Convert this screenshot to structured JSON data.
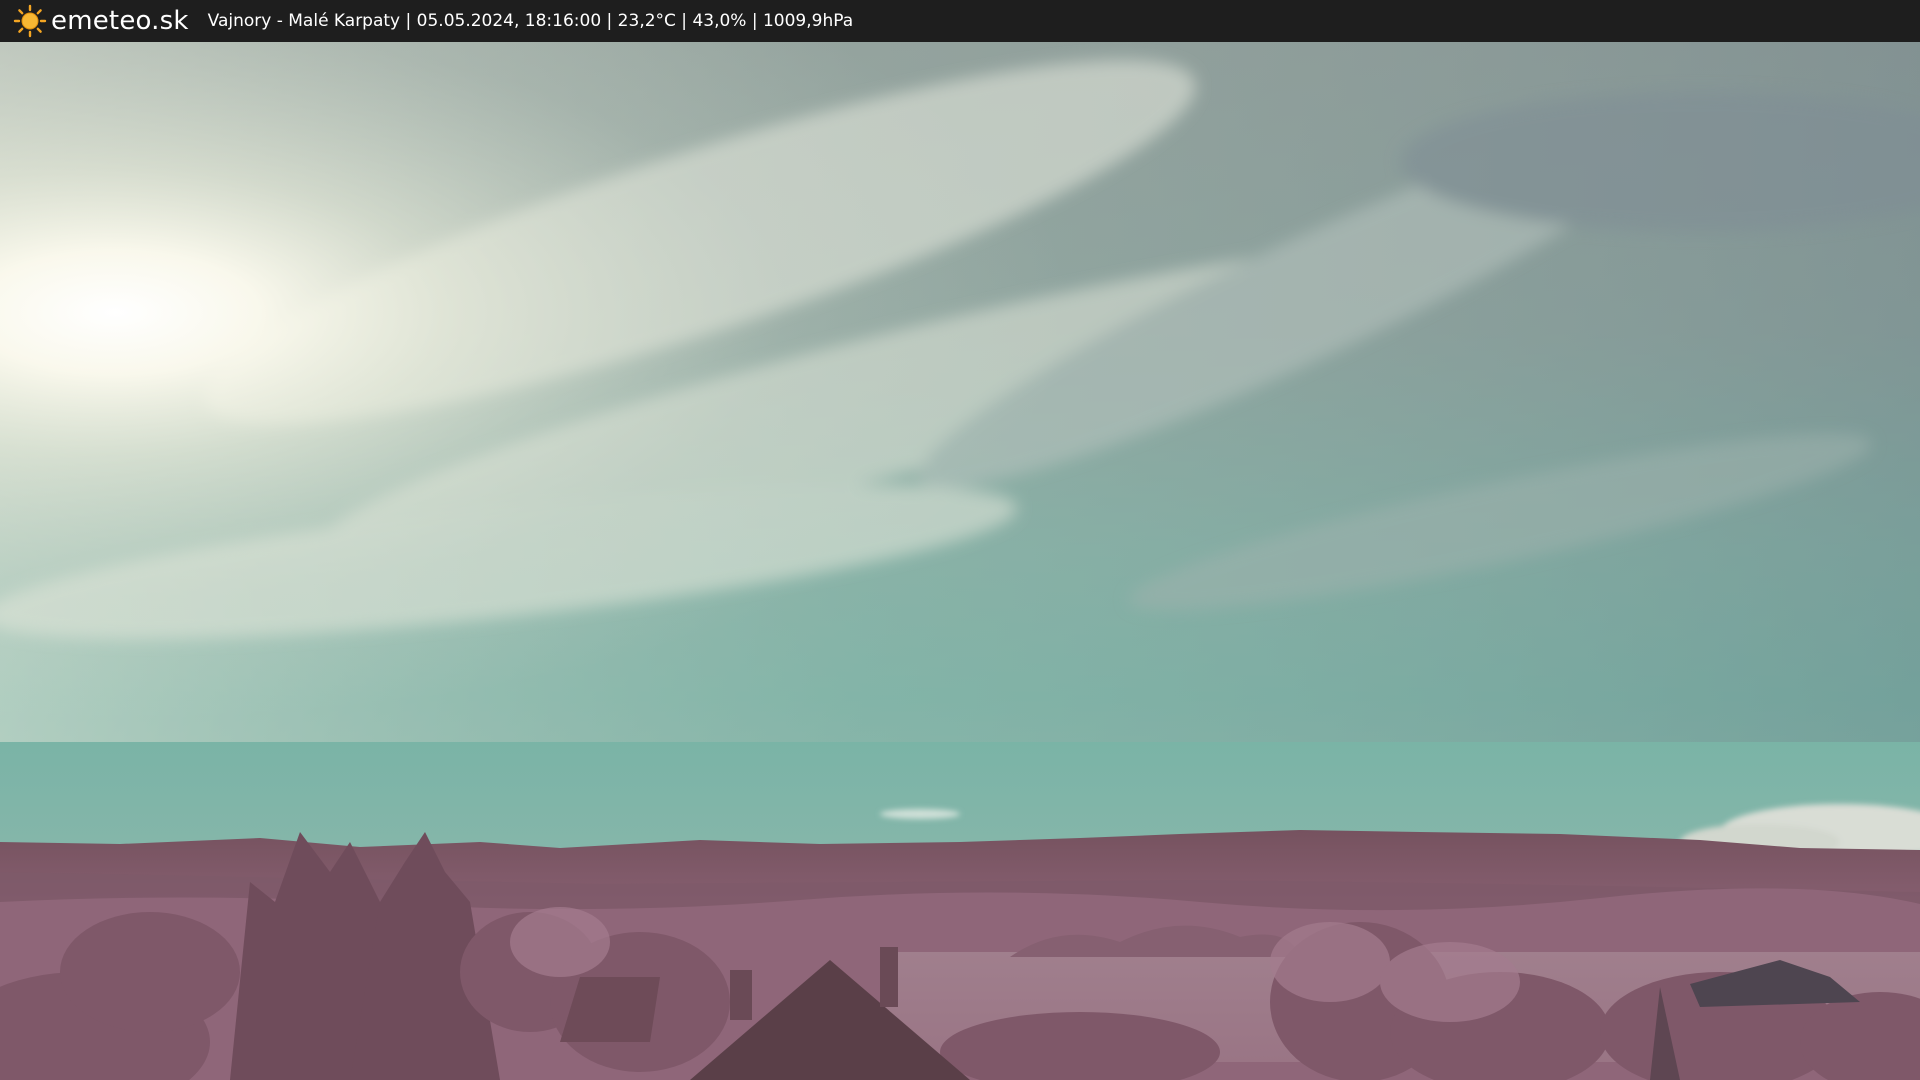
{
  "header": {
    "brand": "emeteo.sk",
    "logo_icon": "sun-icon",
    "caption": "Vajnory - Malé Karpaty | 05.05.2024, 18:16:00 | 23,2°C | 43,0% | 1009,9hPa"
  },
  "colors": {
    "header_bg": "#1e1e1e",
    "sun": "#f5a623",
    "sky_top": "#8a9a96",
    "sky_horizon": "#7ab3a6",
    "hills": "#7a5a68",
    "foliage": "#9a7084"
  }
}
